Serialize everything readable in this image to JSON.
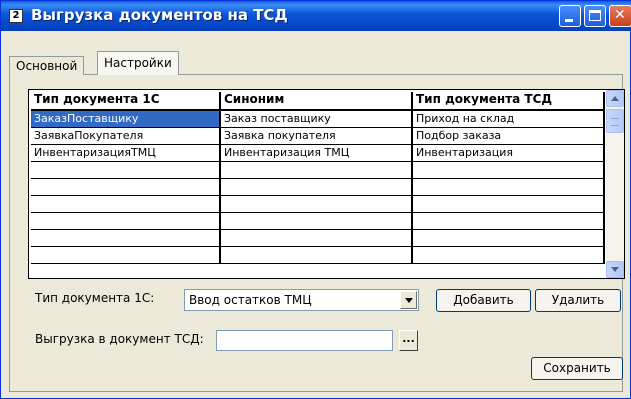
{
  "window": {
    "title": "Выгрузка документов на ТСД",
    "icon": "1c-app-icon",
    "icon_glyph": "2"
  },
  "tabs": [
    {
      "label": "Основной",
      "selected": false
    },
    {
      "label": "Настройки",
      "selected": true
    }
  ],
  "grid": {
    "columns": [
      "Тип документа 1С",
      "Синоним",
      "Тип документа ТСД"
    ],
    "rows": [
      [
        "ЗаказПоставщику",
        "Заказ поставщику",
        "Приход на склад"
      ],
      [
        "ЗаявкаПокупателя",
        "Заявка покупателя",
        "Подбор заказа"
      ],
      [
        "ИнвентаризацияТМЦ",
        "Инвентаризация ТМЦ",
        "Инвентаризация"
      ],
      [
        "",
        "",
        ""
      ],
      [
        "",
        "",
        ""
      ],
      [
        "",
        "",
        ""
      ],
      [
        "",
        "",
        ""
      ],
      [
        "",
        "",
        ""
      ],
      [
        "",
        "",
        ""
      ]
    ],
    "selected_row": 0
  },
  "form": {
    "doc_type_label": "Тип документа 1С:",
    "doc_type_value": "Ввод остатков ТМЦ",
    "add_button": "Добавить",
    "delete_button": "Удалить",
    "export_label": "Выгрузка в документ ТСД:",
    "export_value": "",
    "browse_button": "...",
    "save_button": "Сохранить"
  },
  "colors": {
    "titlebar": "#0a54d8",
    "selection": "#316ac5",
    "window_bg": "#ece9d8"
  }
}
